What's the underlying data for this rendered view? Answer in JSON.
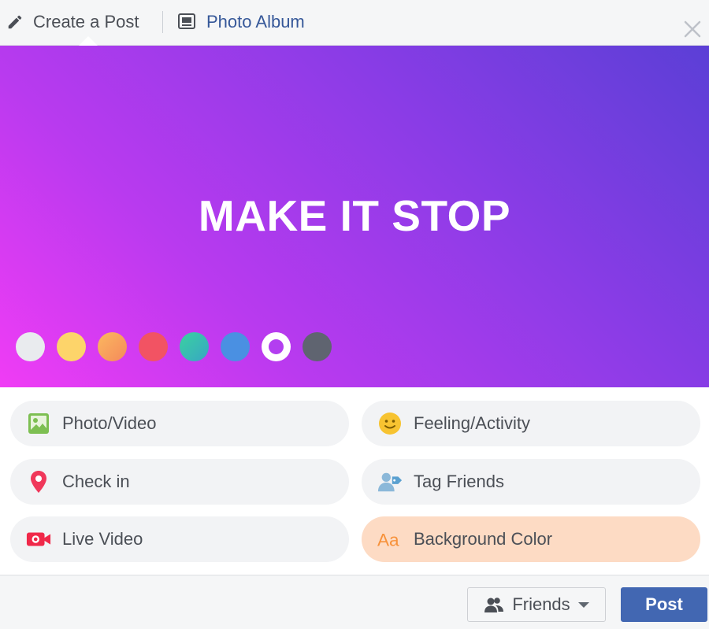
{
  "header": {
    "tabs": [
      {
        "label": "Create a Post",
        "icon": "pencil-icon",
        "active": true
      },
      {
        "label": "Photo Album",
        "icon": "album-icon",
        "active": false
      }
    ],
    "close_icon": "close-icon"
  },
  "canvas": {
    "text": "MAKE IT STOP",
    "swatches": [
      {
        "color": "#e9ebee",
        "selected": false
      },
      {
        "color": "#fdd46a",
        "selected": false
      },
      {
        "color": "#f7a35a",
        "selected": false
      },
      {
        "color": "#f25363",
        "selected": false
      },
      {
        "color": "#3ec6a0",
        "selected": false
      },
      {
        "color": "#4a90e2",
        "selected": false
      },
      {
        "color": "#b33ef0",
        "selected": true
      },
      {
        "color": "#5f6470",
        "selected": false
      }
    ]
  },
  "actions": [
    {
      "label": "Photo/Video",
      "icon": "photo-icon"
    },
    {
      "label": "Feeling/Activity",
      "icon": "smiley-icon"
    },
    {
      "label": "Check in",
      "icon": "location-pin-icon"
    },
    {
      "label": "Tag Friends",
      "icon": "tag-friends-icon"
    },
    {
      "label": "Live Video",
      "icon": "video-camera-icon"
    },
    {
      "label": "Background Color",
      "icon": "text-aa-icon",
      "active": true
    }
  ],
  "footer": {
    "audience_label": "Friends",
    "post_label": "Post"
  },
  "colors": {
    "brand_blue": "#4267b2",
    "link_blue": "#365899",
    "active_action": "#fddbc4"
  }
}
